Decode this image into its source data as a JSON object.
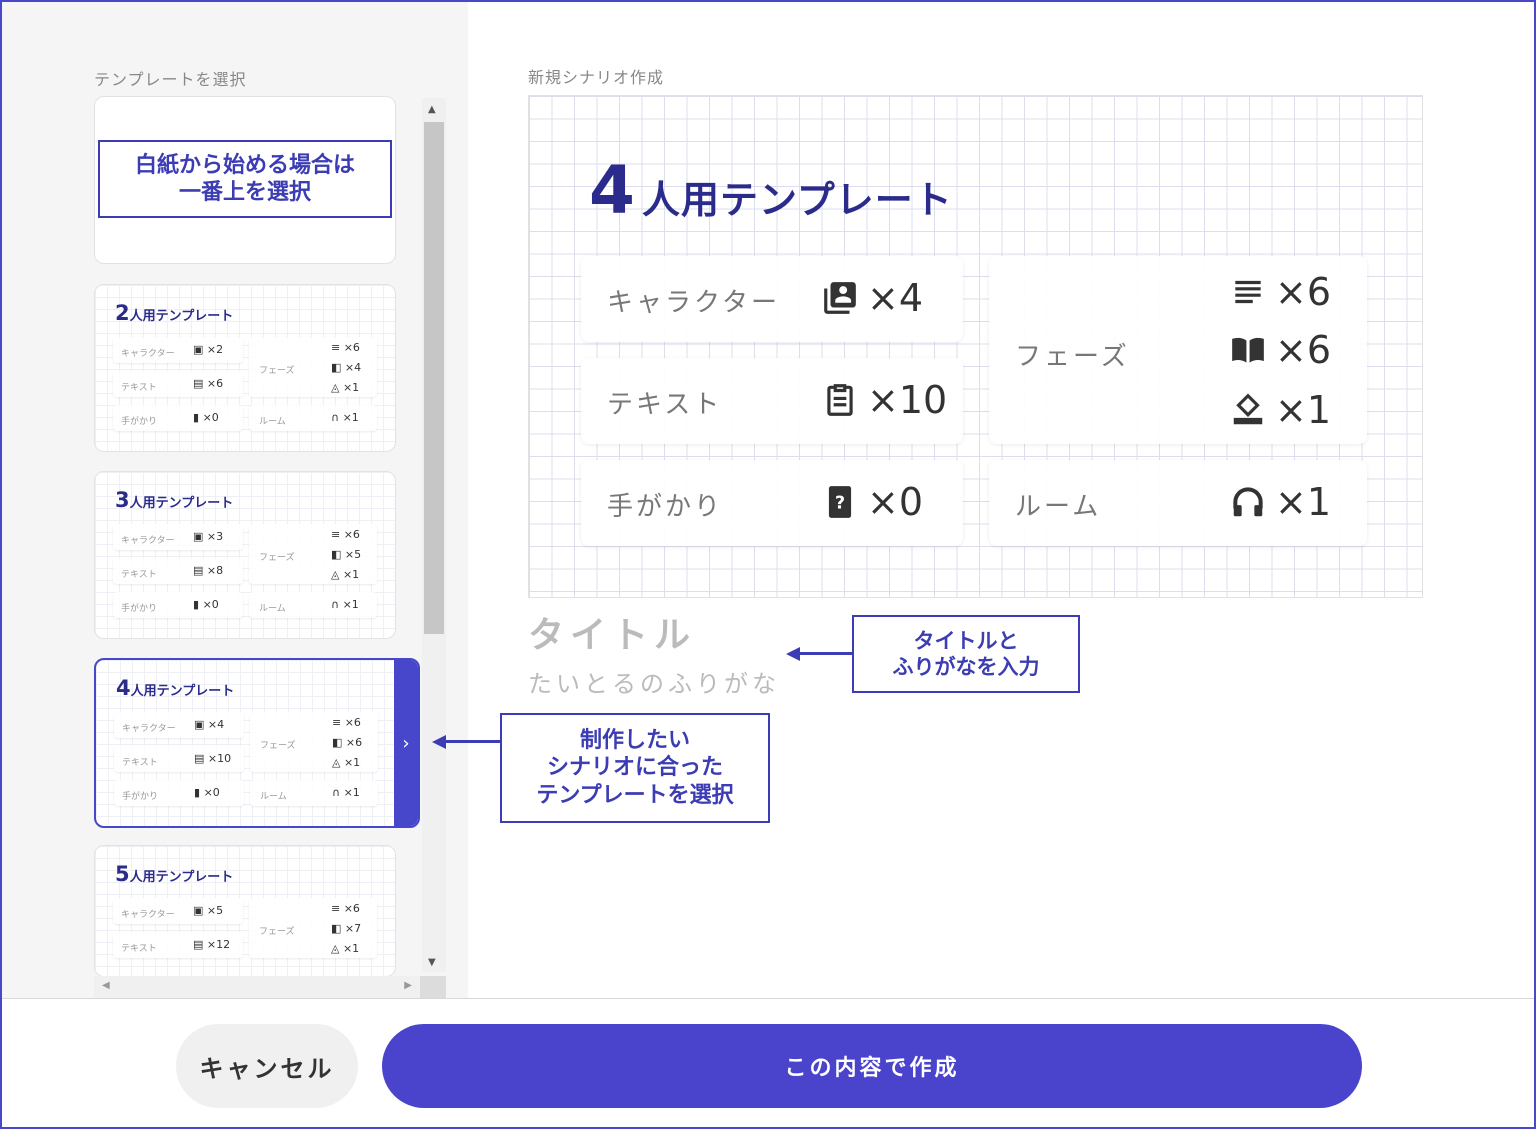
{
  "colors": {
    "accent": "#4a44cc",
    "title": "#2b2b8c",
    "annotation": "#3c3cb4"
  },
  "sidebar": {
    "label": "テンプレートを選択",
    "blank_card_note": [
      "白紙から始める場合は",
      "一番上を選択"
    ],
    "templates": [
      {
        "num": "2",
        "name": "人用テンプレート",
        "character": "×2",
        "text": "×6",
        "clue": "×0",
        "phase": [
          "×6",
          "×4",
          "×1"
        ],
        "room": "×1"
      },
      {
        "num": "3",
        "name": "人用テンプレート",
        "character": "×3",
        "text": "×8",
        "clue": "×0",
        "phase": [
          "×6",
          "×5",
          "×1"
        ],
        "room": "×1"
      },
      {
        "num": "4",
        "name": "人用テンプレート",
        "character": "×4",
        "text": "×10",
        "clue": "×0",
        "phase": [
          "×6",
          "×6",
          "×1"
        ],
        "room": "×1",
        "selected": true
      },
      {
        "num": "5",
        "name": "人用テンプレート",
        "character": "×5",
        "text": "×12",
        "clue": "",
        "phase": [
          "×6",
          "×7",
          "×1"
        ],
        "room": ""
      }
    ],
    "labels": {
      "character": "キャラクター",
      "text": "テキスト",
      "clue": "手がかり",
      "phase": "フェーズ",
      "room": "ルーム"
    },
    "selected_chevron": "›",
    "scroll": {
      "up": "▲",
      "down": "▼",
      "left": "◀",
      "right": "▶"
    }
  },
  "main": {
    "label": "新規シナリオ作成",
    "preview": {
      "num": "4",
      "title": "人用テンプレート",
      "character": {
        "label": "キャラクター",
        "value": "×4",
        "icon": "character-book-icon"
      },
      "text": {
        "label": "テキスト",
        "value": "×10",
        "icon": "clipboard-icon"
      },
      "clue": {
        "label": "手がかり",
        "value": "×0",
        "icon": "question-card-icon"
      },
      "phase": {
        "label": "フェーズ",
        "values": [
          "×6",
          "×6",
          "×1"
        ],
        "icons": [
          "lines-icon",
          "open-book-icon",
          "vote-icon"
        ]
      },
      "room": {
        "label": "ルーム",
        "value": "×1",
        "icon": "headphones-icon"
      }
    },
    "title_placeholder": "タイトル",
    "kana_placeholder": "たいとるのふりがな"
  },
  "annotations": {
    "title_note": [
      "タイトルと",
      "ふりがなを入力"
    ],
    "template_note": [
      "制作したい",
      "シナリオに合った",
      "テンプレートを選択"
    ]
  },
  "footer": {
    "cancel": "キャンセル",
    "create": "この内容で作成"
  }
}
